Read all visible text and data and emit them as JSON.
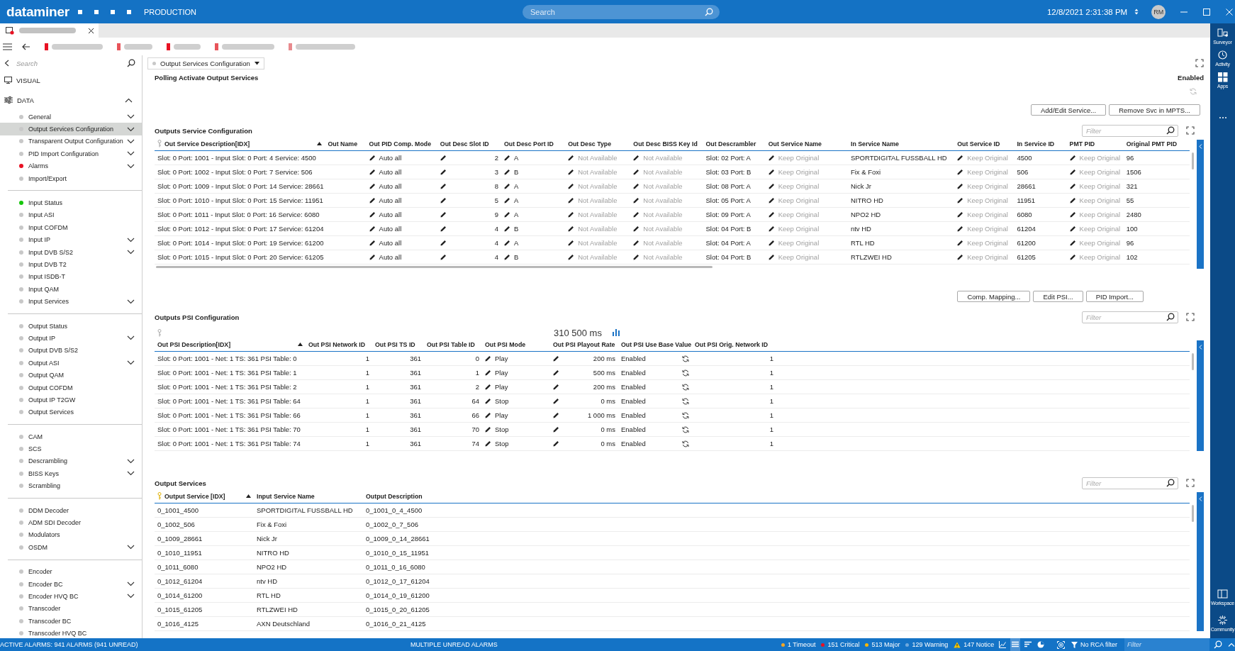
{
  "app": {
    "logo": "dataminer",
    "context": "PRODUCTION",
    "search_placeholder": "Search",
    "datetime": "12/8/2021 2:31:38 PM",
    "avatar": "RM"
  },
  "sidebar": {
    "search_placeholder": "Search",
    "visual": "VISUAL",
    "data": {
      "label": "DATA",
      "expanded": true,
      "groups": [
        [
          {
            "label": "General",
            "color": "#c8c8c8",
            "expandable": true,
            "selected": false
          },
          {
            "label": "Output Services Configuration",
            "color": "#c8c8c8",
            "expandable": true,
            "selected": true
          },
          {
            "label": "Transparent Output Configuration",
            "color": "#c8c8c8",
            "expandable": true,
            "selected": false
          },
          {
            "label": "PID Import Configuration",
            "color": "#c8c8c8",
            "expandable": true,
            "selected": false
          },
          {
            "label": "Alarms",
            "color": "#e81123",
            "expandable": true,
            "selected": false
          },
          {
            "label": "Import/Export",
            "color": "#c8c8c8",
            "expandable": false,
            "selected": false
          }
        ],
        [
          {
            "label": "Input Status",
            "color": "#16c60c",
            "expandable": false,
            "selected": false
          },
          {
            "label": "Input ASI",
            "color": "#c8c8c8",
            "expandable": false,
            "selected": false
          },
          {
            "label": "Input COFDM",
            "color": "#c8c8c8",
            "expandable": false,
            "selected": false
          },
          {
            "label": "Input IP",
            "color": "#c8c8c8",
            "expandable": true,
            "selected": false
          },
          {
            "label": "Input DVB S/S2",
            "color": "#c8c8c8",
            "expandable": true,
            "selected": false
          },
          {
            "label": "Input DVB T2",
            "color": "#c8c8c8",
            "expandable": false,
            "selected": false
          },
          {
            "label": "Input ISDB-T",
            "color": "#c8c8c8",
            "expandable": false,
            "selected": false
          },
          {
            "label": "Input QAM",
            "color": "#c8c8c8",
            "expandable": false,
            "selected": false
          },
          {
            "label": "Input Services",
            "color": "#c8c8c8",
            "expandable": true,
            "selected": false
          }
        ],
        [
          {
            "label": "Output Status",
            "color": "#c8c8c8",
            "expandable": false,
            "selected": false
          },
          {
            "label": "Output IP",
            "color": "#c8c8c8",
            "expandable": true,
            "selected": false
          },
          {
            "label": "Output DVB S/S2",
            "color": "#c8c8c8",
            "expandable": false,
            "selected": false
          },
          {
            "label": "Output ASI",
            "color": "#c8c8c8",
            "expandable": true,
            "selected": false
          },
          {
            "label": "Output QAM",
            "color": "#c8c8c8",
            "expandable": false,
            "selected": false
          },
          {
            "label": "Output COFDM",
            "color": "#c8c8c8",
            "expandable": false,
            "selected": false
          },
          {
            "label": "Output IP T2GW",
            "color": "#c8c8c8",
            "expandable": false,
            "selected": false
          },
          {
            "label": "Output Services",
            "color": "#c8c8c8",
            "expandable": false,
            "selected": false
          }
        ],
        [
          {
            "label": "CAM",
            "color": "#c8c8c8",
            "expandable": false,
            "selected": false
          },
          {
            "label": "SCS",
            "color": "#c8c8c8",
            "expandable": false,
            "selected": false
          },
          {
            "label": "Descrambling",
            "color": "#c8c8c8",
            "expandable": true,
            "selected": false
          },
          {
            "label": "BISS Keys",
            "color": "#c8c8c8",
            "expandable": true,
            "selected": false
          },
          {
            "label": "Scrambling",
            "color": "#c8c8c8",
            "expandable": false,
            "selected": false
          }
        ],
        [
          {
            "label": "DDM Decoder",
            "color": "#c8c8c8",
            "expandable": false,
            "selected": false
          },
          {
            "label": "ADM SDI Decoder",
            "color": "#c8c8c8",
            "expandable": false,
            "selected": false
          },
          {
            "label": "Modulators",
            "color": "#c8c8c8",
            "expandable": false,
            "selected": false
          },
          {
            "label": "OSDM",
            "color": "#c8c8c8",
            "expandable": true,
            "selected": false
          }
        ],
        [
          {
            "label": "Encoder",
            "color": "#c8c8c8",
            "expandable": false,
            "selected": false
          },
          {
            "label": "Encoder BC",
            "color": "#c8c8c8",
            "expandable": true,
            "selected": false
          },
          {
            "label": "Encoder HVQ BC",
            "color": "#c8c8c8",
            "expandable": true,
            "selected": false
          },
          {
            "label": "Transcoder",
            "color": "#c8c8c8",
            "expandable": false,
            "selected": false
          },
          {
            "label": "Transcoder BC",
            "color": "#c8c8c8",
            "expandable": false,
            "selected": false
          },
          {
            "label": "Transcoder HVQ BC",
            "color": "#c8c8c8",
            "expandable": false,
            "selected": false
          }
        ]
      ]
    }
  },
  "page": {
    "selector": "Output Services Configuration",
    "polling_label": "Polling Activate Output Services",
    "polling_value": "Enabled"
  },
  "sections": [
    {
      "buttons": [
        "Add/Edit Service...",
        "Remove Svc in MPTS..."
      ],
      "title": "Outputs Service Configuration",
      "filter_placeholder": "Filter",
      "columns": [
        {
          "label": "Out Service Description[IDX]",
          "kind": "key_text",
          "sorted": true
        },
        {
          "label": "Out Name",
          "kind": "blank"
        },
        {
          "label": "Out PID Comp. Mode",
          "kind": "edit"
        },
        {
          "label": "Out Desc Slot ID",
          "kind": "edit_number"
        },
        {
          "label": "Out Desc Port ID",
          "kind": "edit"
        },
        {
          "label": "Out Desc Type",
          "kind": "edit_muted"
        },
        {
          "label": "Out Desc BISS Key Id",
          "kind": "edit_muted"
        },
        {
          "label": "Out Descrambler",
          "kind": "text"
        },
        {
          "label": "Out Service Name",
          "kind": "edit_muted"
        },
        {
          "label": "In Service Name",
          "kind": "text"
        },
        {
          "label": "Out Service ID",
          "kind": "edit_muted"
        },
        {
          "label": "In Service ID",
          "kind": "text"
        },
        {
          "label": "PMT PID",
          "kind": "edit_muted"
        },
        {
          "label": "Original PMT PID",
          "kind": "text"
        }
      ],
      "rows": [
        [
          "Slot: 0 Port: 1001 - Input Slot: 0 Port: 4 Service: 4500",
          "",
          "Auto all",
          "2",
          "A",
          "Not Available",
          "Not Available",
          "Slot: 02 Port: A",
          "Keep Original",
          "SPORTDIGITAL FUSSBALL HD",
          "Keep Original",
          "4500",
          "Keep Original",
          "96"
        ],
        [
          "Slot: 0 Port: 1002 - Input Slot: 0 Port: 7 Service: 506",
          "",
          "Auto all",
          "3",
          "B",
          "Not Available",
          "Not Available",
          "Slot: 03 Port: B",
          "Keep Original",
          "Fix & Foxi",
          "Keep Original",
          "506",
          "Keep Original",
          "1506"
        ],
        [
          "Slot: 0 Port: 1009 - Input Slot: 0 Port: 14 Service: 28661",
          "",
          "Auto all",
          "8",
          "A",
          "Not Available",
          "Not Available",
          "Slot: 08 Port: A",
          "Keep Original",
          "Nick Jr",
          "Keep Original",
          "28661",
          "Keep Original",
          "321"
        ],
        [
          "Slot: 0 Port: 1010 - Input Slot: 0 Port: 15 Service: 11951",
          "",
          "Auto all",
          "5",
          "A",
          "Not Available",
          "Not Available",
          "Slot: 05 Port: A",
          "Keep Original",
          "NITRO HD",
          "Keep Original",
          "11951",
          "Keep Original",
          "55"
        ],
        [
          "Slot: 0 Port: 1011 - Input Slot: 0 Port: 16 Service: 6080",
          "",
          "Auto all",
          "9",
          "A",
          "Not Available",
          "Not Available",
          "Slot: 09 Port: A",
          "Keep Original",
          "NPO2 HD",
          "Keep Original",
          "6080",
          "Keep Original",
          "2480"
        ],
        [
          "Slot: 0 Port: 1012 - Input Slot: 0 Port: 17 Service: 61204",
          "",
          "Auto all",
          "4",
          "B",
          "Not Available",
          "Not Available",
          "Slot: 04 Port: B",
          "Keep Original",
          "ntv HD",
          "Keep Original",
          "61204",
          "Keep Original",
          "100"
        ],
        [
          "Slot: 0 Port: 1014 - Input Slot: 0 Port: 19 Service: 61200",
          "",
          "Auto all",
          "4",
          "A",
          "Not Available",
          "Not Available",
          "Slot: 04 Port: A",
          "Keep Original",
          "RTL HD",
          "Keep Original",
          "61200",
          "Keep Original",
          "96"
        ],
        [
          "Slot: 0 Port: 1015 - Input Slot: 0 Port: 20 Service: 61205",
          "",
          "Auto all",
          "4",
          "B",
          "Not Available",
          "Not Available",
          "Slot: 04 Port: B",
          "Keep Original",
          "RTLZWEI HD",
          "Keep Original",
          "61205",
          "Keep Original",
          "102"
        ]
      ]
    },
    {
      "buttons": [
        "Comp. Mapping...",
        "Edit PSI...",
        "PID Import..."
      ],
      "title": "Outputs PSI Configuration",
      "filter_placeholder": "Filter",
      "total": "310 500 ms",
      "columns": [
        {
          "label": "Out PSI Description[IDX]",
          "kind": "text",
          "sorted": true
        },
        {
          "label": "Out PSI Network ID",
          "kind": "number"
        },
        {
          "label": "Out PSI TS ID",
          "kind": "number"
        },
        {
          "label": "Out PSI Table ID",
          "kind": "number"
        },
        {
          "label": "Out PSI Mode",
          "kind": "edit"
        },
        {
          "label": "Out PSI Playout Rate",
          "kind": "edit_number"
        },
        {
          "label": "Out PSI Use Base Value",
          "kind": "text_sync"
        },
        {
          "label": "Out PSI Orig. Network ID",
          "kind": "number"
        }
      ],
      "rows": [
        [
          "Slot: 0 Port: 1001 - Net: 1 TS: 361 PSI Table: 0",
          "1",
          "361",
          "0",
          "Play",
          "200 ms",
          "Enabled",
          "1"
        ],
        [
          "Slot: 0 Port: 1001 - Net: 1 TS: 361 PSI Table: 1",
          "1",
          "361",
          "1",
          "Play",
          "500 ms",
          "Enabled",
          "1"
        ],
        [
          "Slot: 0 Port: 1001 - Net: 1 TS: 361 PSI Table: 2",
          "1",
          "361",
          "2",
          "Play",
          "200 ms",
          "Enabled",
          "1"
        ],
        [
          "Slot: 0 Port: 1001 - Net: 1 TS: 361 PSI Table: 64",
          "1",
          "361",
          "64",
          "Stop",
          "0 ms",
          "Enabled",
          "1"
        ],
        [
          "Slot: 0 Port: 1001 - Net: 1 TS: 361 PSI Table: 66",
          "1",
          "361",
          "66",
          "Play",
          "1 000 ms",
          "Enabled",
          "1"
        ],
        [
          "Slot: 0 Port: 1001 - Net: 1 TS: 361 PSI Table: 70",
          "1",
          "361",
          "70",
          "Stop",
          "0 ms",
          "Enabled",
          "1"
        ],
        [
          "Slot: 0 Port: 1001 - Net: 1 TS: 361 PSI Table: 74",
          "1",
          "361",
          "74",
          "Stop",
          "0 ms",
          "Enabled",
          "1"
        ]
      ]
    },
    {
      "title": "Output Services",
      "filter_placeholder": "Filter",
      "columns": [
        {
          "label": "Output Service [IDX]",
          "kind": "key_text",
          "sorted": true
        },
        {
          "label": "Input Service Name",
          "kind": "text"
        },
        {
          "label": "Output Description",
          "kind": "text"
        }
      ],
      "rows": [
        [
          "0_1001_4500",
          "SPORTDIGITAL FUSSBALL HD",
          "0_1001_0_4_4500"
        ],
        [
          "0_1002_506",
          "Fix & Foxi",
          "0_1002_0_7_506"
        ],
        [
          "0_1009_28661",
          "Nick Jr",
          "0_1009_0_14_28661"
        ],
        [
          "0_1010_11951",
          "NITRO HD",
          "0_1010_0_15_11951"
        ],
        [
          "0_1011_6080",
          "NPO2 HD",
          "0_1011_0_16_6080"
        ],
        [
          "0_1012_61204",
          "ntv HD",
          "0_1012_0_17_61204"
        ],
        [
          "0_1014_61200",
          "RTL HD",
          "0_1014_0_19_61200"
        ],
        [
          "0_1015_61205",
          "RTLZWEI HD",
          "0_1015_0_20_61205"
        ],
        [
          "0_1016_4125",
          "AXN Deutschland",
          "0_1016_0_21_4125"
        ]
      ]
    }
  ],
  "status_bar": {
    "alarms": "ACTIVE ALARMS: 941 ALARMS (941 UNREAD)",
    "message": "MULTIPLE UNREAD ALARMS",
    "counts": [
      {
        "label": "1 Timeout",
        "kind": "dot",
        "color": "#f5a623"
      },
      {
        "label": "151 Critical",
        "kind": "dot",
        "color": "#e81123"
      },
      {
        "label": "513 Major",
        "kind": "dot",
        "color": "#f7b500"
      },
      {
        "label": "129 Warning",
        "kind": "dot",
        "color": "#6fa8dc"
      },
      {
        "label": "147 Notice",
        "kind": "triangle",
        "color": "#f7c600"
      }
    ],
    "views": [
      {
        "selected": false
      },
      {
        "selected": true
      },
      {
        "selected": false
      },
      {
        "selected": false
      }
    ],
    "rca_filter": "No RCA filter",
    "filter_placeholder": "Filter"
  },
  "rail": {
    "top": [
      {
        "label": "Surveyor"
      },
      {
        "label": "Activity"
      },
      {
        "label": "Apps"
      }
    ],
    "bottom": [
      {
        "label": "Workspace"
      },
      {
        "label": "Community"
      }
    ]
  }
}
